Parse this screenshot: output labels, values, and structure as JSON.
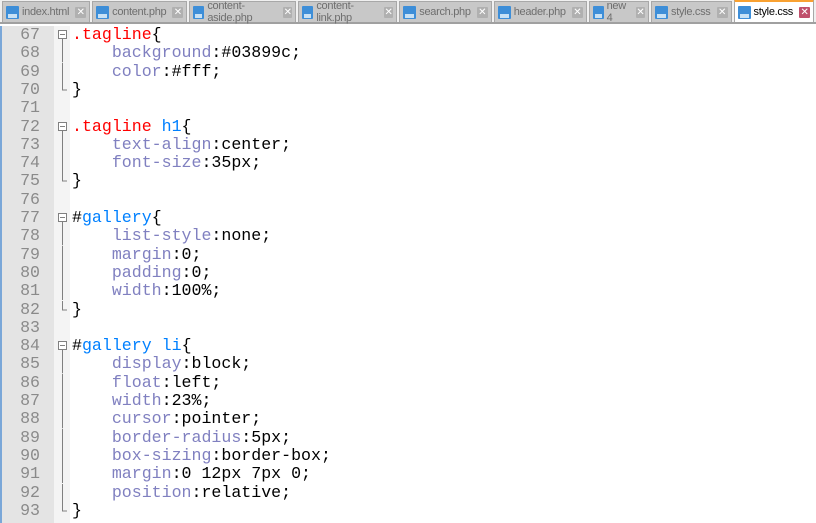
{
  "tabs": [
    {
      "label": "index.html",
      "active": false
    },
    {
      "label": "content.php",
      "active": false
    },
    {
      "label": "content-aside.php",
      "active": false
    },
    {
      "label": "content-link.php",
      "active": false
    },
    {
      "label": "search.php",
      "active": false
    },
    {
      "label": "header.php",
      "active": false
    },
    {
      "label": "new 4",
      "active": false
    },
    {
      "label": "style.css",
      "active": false
    },
    {
      "label": "style.css",
      "active": true
    }
  ],
  "lines": [
    {
      "n": "67",
      "fold": "start",
      "tokens": [
        [
          ".tagline",
          "sel"
        ],
        [
          "{",
          "p"
        ]
      ]
    },
    {
      "n": "68",
      "fold": "mid",
      "tokens": [
        [
          "    background",
          "prop"
        ],
        [
          ":#03899c;",
          "val"
        ]
      ]
    },
    {
      "n": "69",
      "fold": "mid",
      "tokens": [
        [
          "    color",
          "prop"
        ],
        [
          ":#fff;",
          "val"
        ]
      ]
    },
    {
      "n": "70",
      "fold": "end",
      "tokens": [
        [
          "}",
          "p"
        ]
      ]
    },
    {
      "n": "71",
      "fold": "",
      "tokens": []
    },
    {
      "n": "72",
      "fold": "start",
      "tokens": [
        [
          ".tagline",
          "sel"
        ],
        [
          " h1",
          "id"
        ],
        [
          "{",
          "p"
        ]
      ]
    },
    {
      "n": "73",
      "fold": "mid",
      "tokens": [
        [
          "    text-align",
          "prop"
        ],
        [
          ":center;",
          "val"
        ]
      ]
    },
    {
      "n": "74",
      "fold": "mid",
      "tokens": [
        [
          "    font-size",
          "prop"
        ],
        [
          ":35px;",
          "val"
        ]
      ]
    },
    {
      "n": "75",
      "fold": "end",
      "tokens": [
        [
          "}",
          "p"
        ]
      ]
    },
    {
      "n": "76",
      "fold": "",
      "tokens": []
    },
    {
      "n": "77",
      "fold": "start",
      "tokens": [
        [
          "#",
          "p"
        ],
        [
          "gallery",
          "id"
        ],
        [
          "{",
          "p"
        ]
      ]
    },
    {
      "n": "78",
      "fold": "mid",
      "tokens": [
        [
          "    list-style",
          "prop"
        ],
        [
          ":none;",
          "val"
        ]
      ]
    },
    {
      "n": "79",
      "fold": "mid",
      "tokens": [
        [
          "    margin",
          "prop"
        ],
        [
          ":0;",
          "val"
        ]
      ]
    },
    {
      "n": "80",
      "fold": "mid",
      "tokens": [
        [
          "    padding",
          "prop"
        ],
        [
          ":0;",
          "val"
        ]
      ]
    },
    {
      "n": "81",
      "fold": "mid",
      "tokens": [
        [
          "    width",
          "prop"
        ],
        [
          ":100%;",
          "val"
        ]
      ]
    },
    {
      "n": "82",
      "fold": "end",
      "tokens": [
        [
          "}",
          "p"
        ]
      ]
    },
    {
      "n": "83",
      "fold": "",
      "tokens": []
    },
    {
      "n": "84",
      "fold": "start",
      "tokens": [
        [
          "#",
          "p"
        ],
        [
          "gallery li",
          "id"
        ],
        [
          "{",
          "p"
        ]
      ]
    },
    {
      "n": "85",
      "fold": "mid",
      "tokens": [
        [
          "    display",
          "prop"
        ],
        [
          ":block;",
          "val"
        ]
      ]
    },
    {
      "n": "86",
      "fold": "mid",
      "tokens": [
        [
          "    float",
          "prop"
        ],
        [
          ":left;",
          "val"
        ]
      ]
    },
    {
      "n": "87",
      "fold": "mid",
      "tokens": [
        [
          "    width",
          "prop"
        ],
        [
          ":23%;",
          "val"
        ]
      ]
    },
    {
      "n": "88",
      "fold": "mid",
      "tokens": [
        [
          "    cursor",
          "prop"
        ],
        [
          ":pointer;",
          "val"
        ]
      ]
    },
    {
      "n": "89",
      "fold": "mid",
      "tokens": [
        [
          "    border-radius",
          "prop"
        ],
        [
          ":5px;",
          "val"
        ]
      ]
    },
    {
      "n": "90",
      "fold": "mid",
      "tokens": [
        [
          "    box-sizing",
          "prop"
        ],
        [
          ":border-box;",
          "val"
        ]
      ]
    },
    {
      "n": "91",
      "fold": "mid",
      "tokens": [
        [
          "    margin",
          "prop"
        ],
        [
          ":0 12px 7px 0;",
          "val"
        ]
      ]
    },
    {
      "n": "92",
      "fold": "mid",
      "tokens": [
        [
          "    position",
          "prop"
        ],
        [
          ":relative;",
          "val"
        ]
      ]
    },
    {
      "n": "93",
      "fold": "end",
      "tokens": [
        [
          "}",
          "p"
        ]
      ]
    }
  ],
  "colors": {
    "selector": "#ff0000",
    "id": "#0080ff",
    "property": "#8080c0",
    "active_tab_accent": "#f9a131"
  }
}
